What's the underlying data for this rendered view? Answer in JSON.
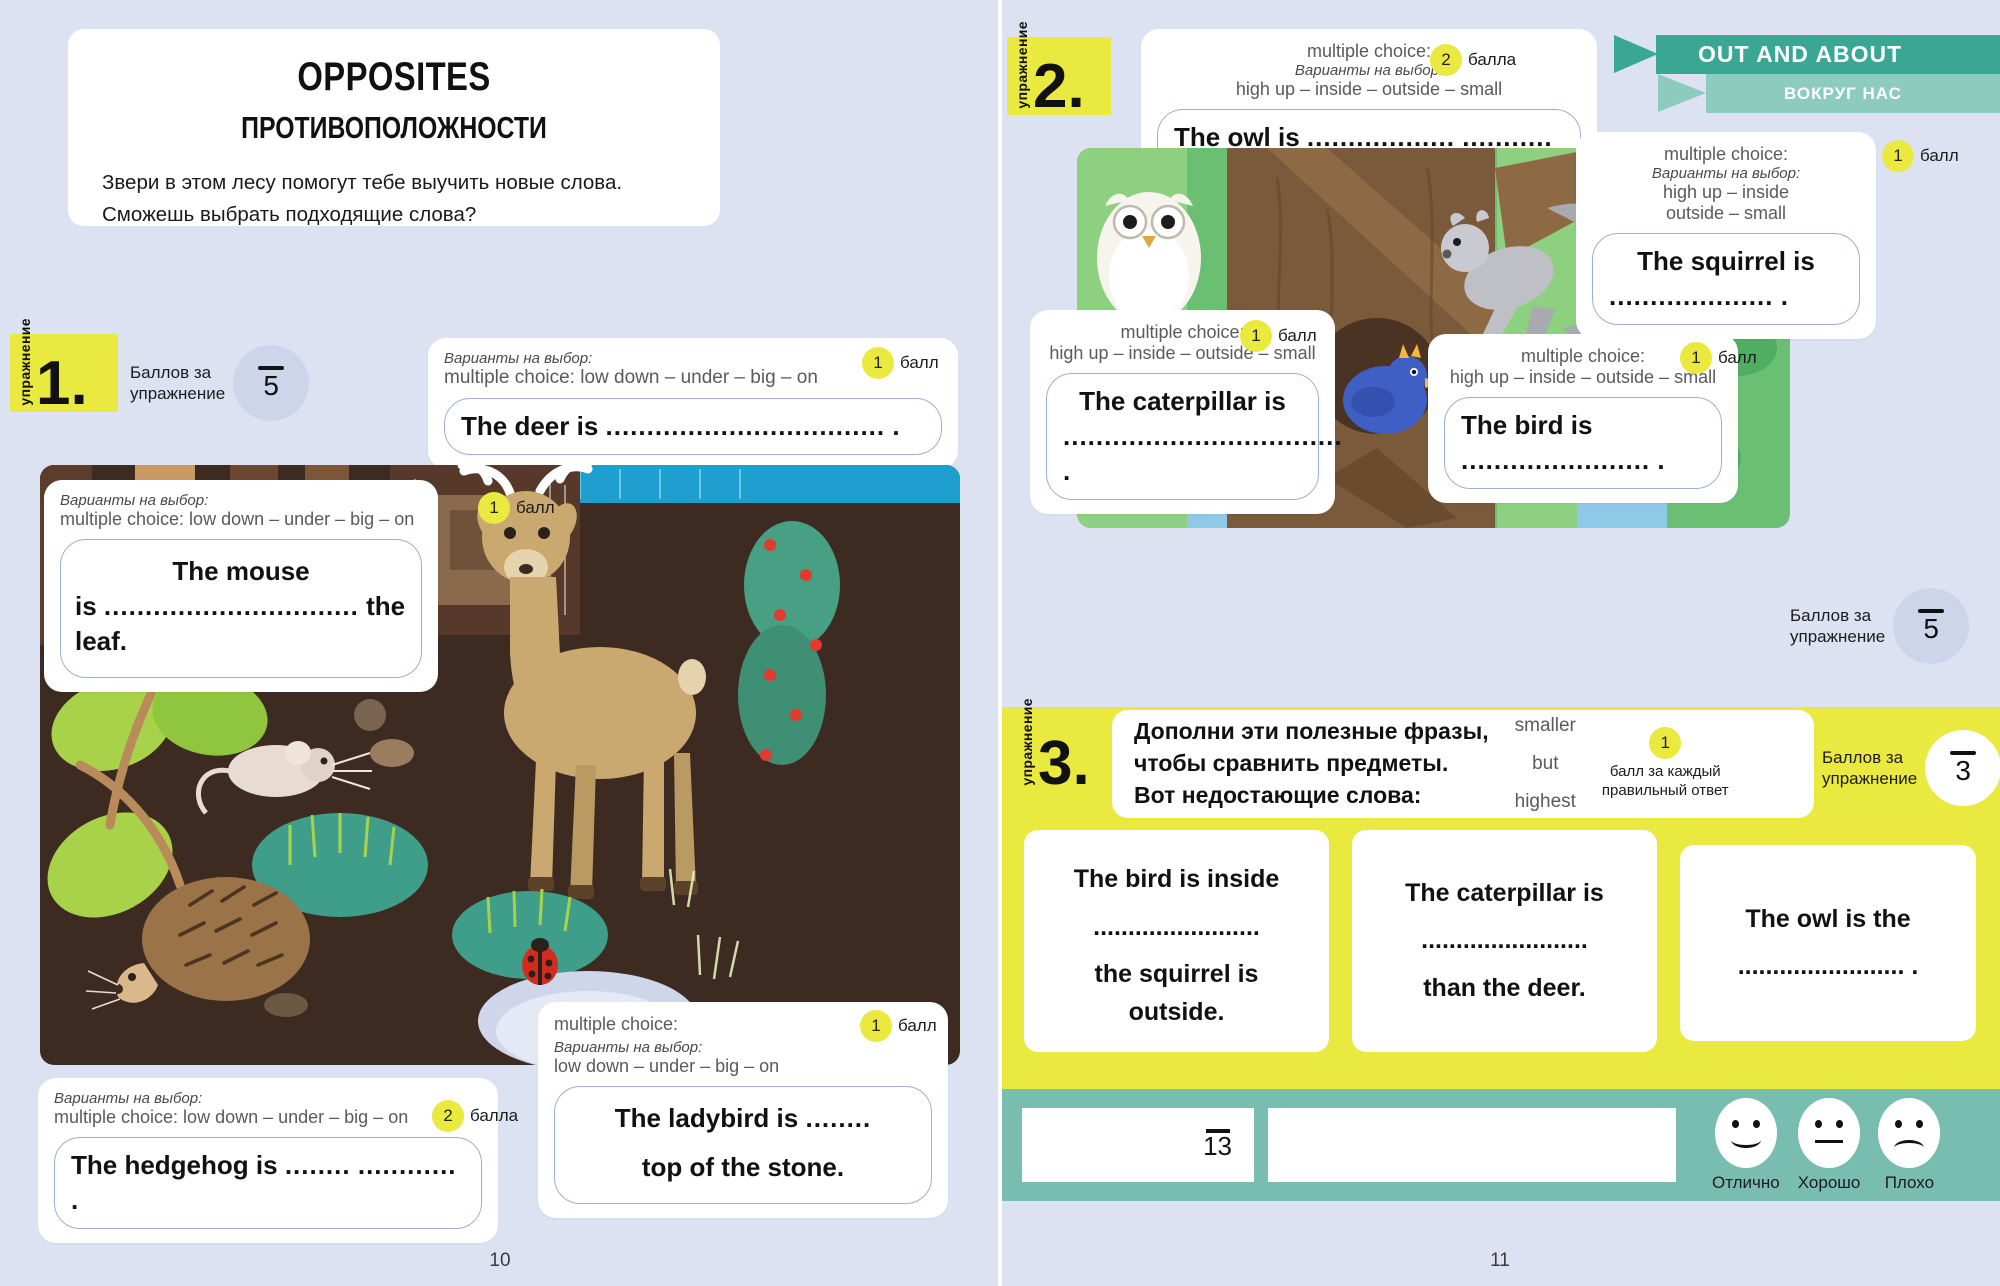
{
  "colors": {
    "page_bg": "#dde2f2",
    "accent_yellow": "#eae93f",
    "teal_dark": "#3aa694",
    "teal_light": "#8ccbbe",
    "teal_footer": "#79bdb0",
    "answer_border": "#9bb0d6"
  },
  "left_page": {
    "page_number": "10",
    "title": {
      "english": "OPPOSITES",
      "russian": "ПРОТИВОПОЛОЖНОСТИ",
      "intro_line1": "Звери в этом лесу помогут тебе выучить новые слова.",
      "intro_line2": "Сможешь выбрать подходящие слова?"
    },
    "exercise": {
      "tab_word": "упражнение",
      "number": "1.",
      "score_label_line1": "Баллов за",
      "score_label_line2": "упражнение",
      "score_denominator": "5"
    },
    "cards": [
      {
        "id": "deer",
        "hint_italic": "Варианты на выбор:",
        "hint_choices": "multiple choice: low down – under – big – on",
        "sentence": "The deer is",
        "dots": "..................................",
        "tail": ".",
        "points_value": "1",
        "points_label": "балл"
      },
      {
        "id": "mouse",
        "hint_italic": "Варианты на выбор:",
        "hint_choices": "multiple choice: low down – under – big – on",
        "sentence_line1": "The mouse",
        "sentence_line2_pre": "is",
        "dots": "...............................",
        "sentence_line2_post": "the leaf.",
        "points_value": "1",
        "points_label": "балл"
      },
      {
        "id": "ladybird",
        "hint_plain": "multiple choice:",
        "hint_italic": "Варианты на выбор:",
        "hint_choices": "low down – under – big – on",
        "sentence_line1": "The ladybird is",
        "dots": "........",
        "sentence_line2": "top of the stone.",
        "points_value": "1",
        "points_label": "балл"
      },
      {
        "id": "hedgehog",
        "hint_italic": "Варианты на выбор:",
        "hint_choices": "multiple choice: low down – under – big – on",
        "sentence": "The hedgehog is",
        "dots1": "........",
        "dots2": "............",
        "tail": ".",
        "points_value": "2",
        "points_label": "балла"
      }
    ]
  },
  "right_page": {
    "page_number": "11",
    "banner": {
      "english": "OUT AND ABOUT",
      "russian": "ВОКРУГ НАС"
    },
    "exercise2": {
      "tab_word": "упражнение",
      "number": "2.",
      "score_label_line1": "Баллов за",
      "score_label_line2": "упражнение",
      "score_denominator": "5"
    },
    "exercise2_cards": [
      {
        "id": "owl",
        "hint_plain": "multiple choice:",
        "hint_italic": "Варианты на выбор:",
        "hint_choices": "high up – inside – outside – small",
        "sentence": "The owl is",
        "dots1": "..................",
        "dots2": "...........",
        "tail": ".",
        "points_value": "2",
        "points_label": "балла"
      },
      {
        "id": "squirrel",
        "hint_plain": "multiple choice:",
        "hint_italic": "Варианты на выбор:",
        "hint_choices_line1": "high up – inside",
        "hint_choices_line2": "outside – small",
        "sentence": "The squirrel is",
        "dots": "....................",
        "tail": ".",
        "points_value": "1",
        "points_label": "балл"
      },
      {
        "id": "caterpillar",
        "hint_plain": "multiple choice:",
        "hint_choices": "high up – inside – outside – small",
        "sentence_line1": "The caterpillar is",
        "dots": "..................................",
        "tail": ".",
        "points_value": "1",
        "points_label": "балл"
      },
      {
        "id": "bird",
        "hint_plain": "multiple choice:",
        "hint_choices": "high up – inside – outside – small",
        "sentence": "The bird is",
        "dots": ".......................",
        "tail": ".",
        "points_value": "1",
        "points_label": "балл"
      }
    ],
    "exercise3": {
      "tab_word": "упражнение",
      "number": "3.",
      "instr_line1": "Дополни эти полезные фразы,",
      "instr_line2": "чтобы сравнить предметы.",
      "instr_line3": "Вот недостающие слова:",
      "words": [
        "smaller",
        "but",
        "highest"
      ],
      "points_value": "1",
      "points_note_line1": "балл за каждый",
      "points_note_line2": "правильный ответ",
      "score_label_line1": "Баллов за",
      "score_label_line2": "упражнение",
      "score_denominator": "3",
      "cards": [
        {
          "line1": "The bird is inside",
          "dots": "........................",
          "line2": "the squirrel is",
          "line3": "outside."
        },
        {
          "line1": "The caterpillar is",
          "dots": "........................",
          "line2": "than the deer."
        },
        {
          "line1": "The owl is the",
          "dots": "........................",
          "tail": "."
        }
      ]
    },
    "footer": {
      "total_denominator": "13",
      "faces": [
        {
          "icon": "smiley-face-icon",
          "label": "Отлично"
        },
        {
          "icon": "neutral-face-icon",
          "label": "Хорошо"
        },
        {
          "icon": "sad-face-icon",
          "label": "Плохо"
        }
      ]
    }
  }
}
